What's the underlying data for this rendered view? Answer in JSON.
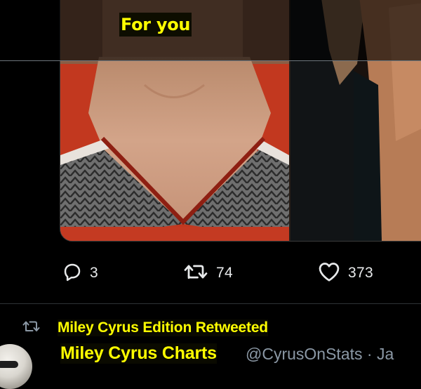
{
  "tab_bar": {
    "active_tab": "For you"
  },
  "tweet_actions": {
    "reply_count": "3",
    "retweet_count": "74",
    "like_count": "373"
  },
  "next_tweet": {
    "retweet_context": "Miley Cyrus Edition Retweeted",
    "author_name": "Miley Cyrus Charts",
    "author_handle": "@CyrusOnStats · Ja"
  },
  "icons": {
    "reply": "reply-icon",
    "retweet": "retweet-icon",
    "like": "heart-icon",
    "retweet_context": "retweet-small-icon"
  },
  "colors": {
    "background": "#000000",
    "highlight_text": "#ffff00",
    "primary_text": "#e7e9ea",
    "secondary_text": "#8b98a5",
    "divider": "#2f3336"
  }
}
